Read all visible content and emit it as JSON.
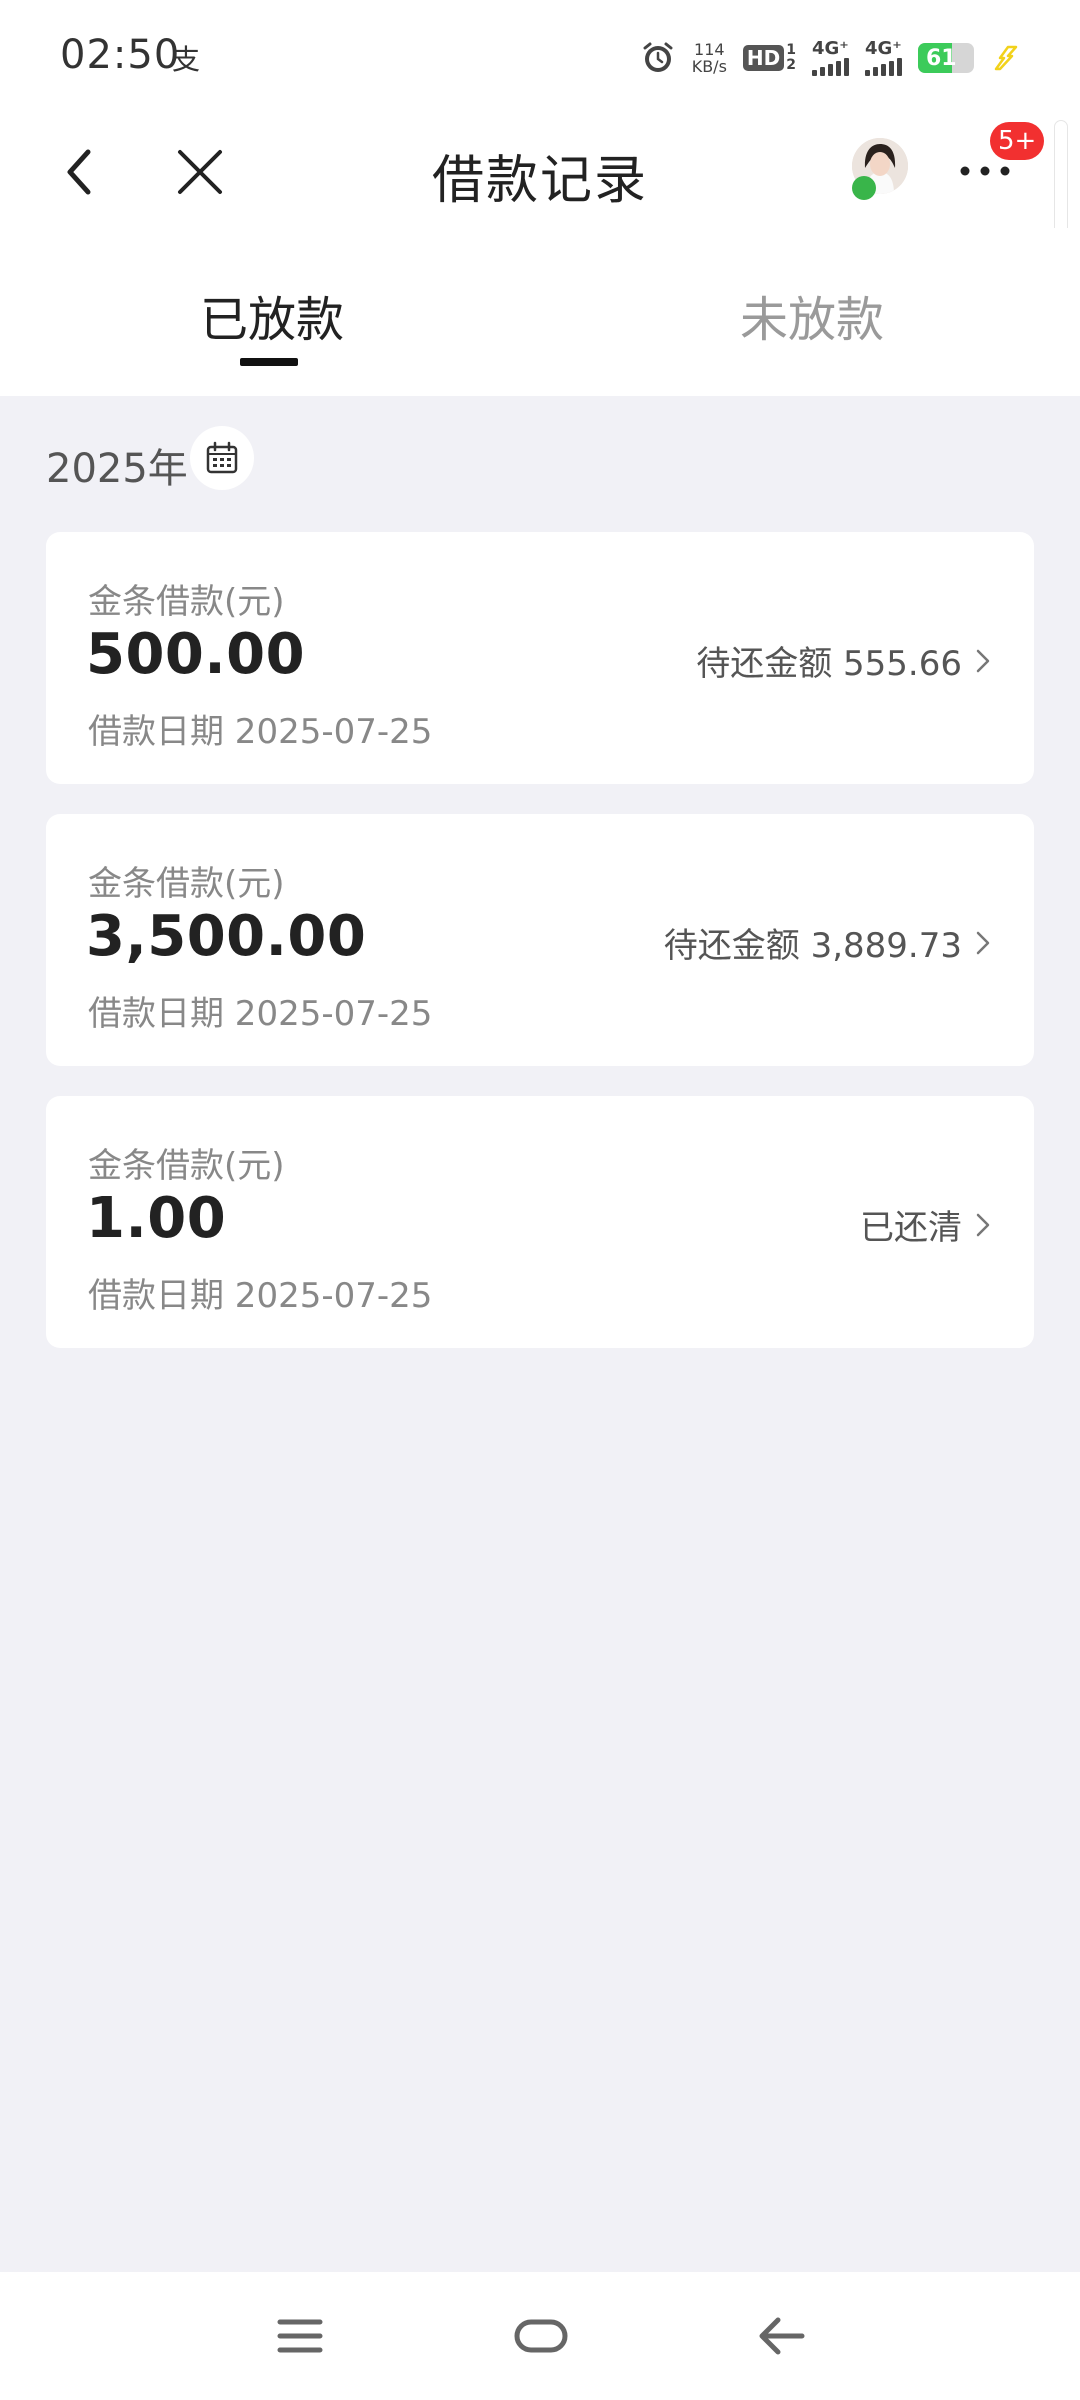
{
  "status_bar": {
    "time": "02:50",
    "app_icon": "支",
    "net_speed_top": "114",
    "net_speed_unit": "KB/s",
    "hd_label": "HD",
    "hd_sim_top": "1",
    "hd_sim_bottom": "2",
    "signal1_label": "4G⁺",
    "signal2_label": "4G⁺",
    "battery_level": "61",
    "battery_fraction": 0.61,
    "accent_battery": "#3ccb5a",
    "charging_color": "#f2d21b"
  },
  "nav": {
    "title": "借款记录",
    "badge": "5+",
    "badge_color": "#f23030"
  },
  "tabs": [
    {
      "label": "已放款",
      "active": true
    },
    {
      "label": "未放款",
      "active": false
    }
  ],
  "year": "2025年",
  "records": [
    {
      "type_label": "金条借款(元)",
      "amount": "500.00",
      "date": "借款日期 2025-07-25",
      "status": "待还金额 555.66"
    },
    {
      "type_label": "金条借款(元)",
      "amount": "3,500.00",
      "date": "借款日期 2025-07-25",
      "status": "待还金额 3,889.73"
    },
    {
      "type_label": "金条借款(元)",
      "amount": "1.00",
      "date": "借款日期 2025-07-25",
      "status": "已还清"
    }
  ]
}
